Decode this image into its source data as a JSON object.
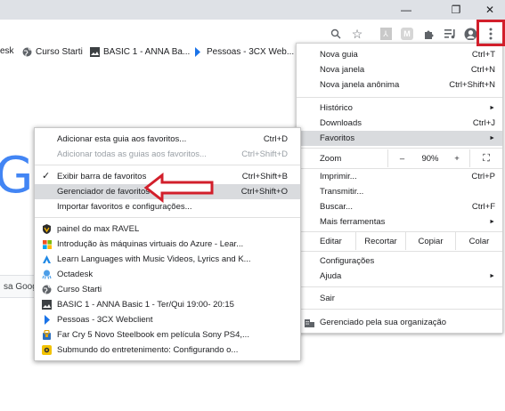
{
  "window_controls": {
    "minimize": "—",
    "maximize": "❐",
    "close": "✕"
  },
  "toolbar": {
    "icons": [
      "search-icon",
      "star-icon",
      "pdf-extension-icon",
      "extension-m-icon",
      "puzzle-icon",
      "media-queue-icon",
      "profile-icon",
      "kebab-menu-icon"
    ]
  },
  "bookmarks_bar": [
    {
      "label": "esk",
      "icon": "none"
    },
    {
      "label": "Curso Starti",
      "icon": "globe-icon"
    },
    {
      "label": "BASIC 1 - ANNA Ba...",
      "icon": "image-icon"
    },
    {
      "label": "Pessoas - 3CX Web...",
      "icon": "chevron-blue-icon"
    }
  ],
  "page": {
    "search_hint": "sa Google"
  },
  "main_menu": {
    "items_top": [
      {
        "label": "Nova guia",
        "shortcut": "Ctrl+T"
      },
      {
        "label": "Nova janela",
        "shortcut": "Ctrl+N"
      },
      {
        "label": "Nova janela anônima",
        "shortcut": "Ctrl+Shift+N"
      }
    ],
    "items_mid": [
      {
        "label": "Histórico",
        "shortcut": "►"
      },
      {
        "label": "Downloads",
        "shortcut": "Ctrl+J"
      },
      {
        "label": "Favoritos",
        "shortcut": "►"
      }
    ],
    "zoom": {
      "label": "Zoom",
      "minus": "–",
      "value": "90%",
      "plus": "+",
      "fullscreen": "⛶"
    },
    "items_tools": [
      {
        "label": "Imprimir...",
        "shortcut": "Ctrl+P"
      },
      {
        "label": "Transmitir...",
        "shortcut": ""
      },
      {
        "label": "Buscar...",
        "shortcut": "Ctrl+F"
      },
      {
        "label": "Mais ferramentas",
        "shortcut": "►"
      }
    ],
    "edit": {
      "label": "Editar",
      "cut": "Recortar",
      "copy": "Copiar",
      "paste": "Colar"
    },
    "items_settings": [
      {
        "label": "Configurações",
        "shortcut": ""
      },
      {
        "label": "Ajuda",
        "shortcut": "►"
      }
    ],
    "exit": "Sair",
    "managed": "Gerenciado pela sua organização"
  },
  "bookmarks_submenu": {
    "add_tab": {
      "label": "Adicionar esta guia aos favoritos...",
      "shortcut": "Ctrl+D"
    },
    "add_all": {
      "label": "Adicionar todas as guias aos favoritos...",
      "shortcut": "Ctrl+Shift+D"
    },
    "show_bar": {
      "label": "Exibir barra de favoritos",
      "shortcut": "Ctrl+Shift+B",
      "check": "✓"
    },
    "manager": {
      "label": "Gerenciador de favoritos",
      "shortcut": "Ctrl+Shift+O"
    },
    "import": {
      "label": "Importar favoritos e configurações..."
    },
    "bookmarks": [
      {
        "label": "painel do max RAVEL",
        "icon": "shield-icon"
      },
      {
        "label": "Introdução às máquinas virtuais do Azure - Lear...",
        "icon": "microsoft-icon"
      },
      {
        "label": "Learn Languages with Music Videos, Lyrics and K...",
        "icon": "lyrics-icon"
      },
      {
        "label": "Octadesk",
        "icon": "octopus-icon"
      },
      {
        "label": "Curso Starti",
        "icon": "globe-icon"
      },
      {
        "label": "BASIC 1 - ANNA Basic 1 - Ter/Qui 19:00- 20:15",
        "icon": "image-icon"
      },
      {
        "label": "Pessoas - 3CX Webclient",
        "icon": "chevron-blue-icon"
      },
      {
        "label": "Far Cry 5 Novo Steelbook em película Sony PS4,...",
        "icon": "bag-icon"
      },
      {
        "label": "Submundo do entretenimento: Configurando o...",
        "icon": "game-icon"
      }
    ]
  }
}
